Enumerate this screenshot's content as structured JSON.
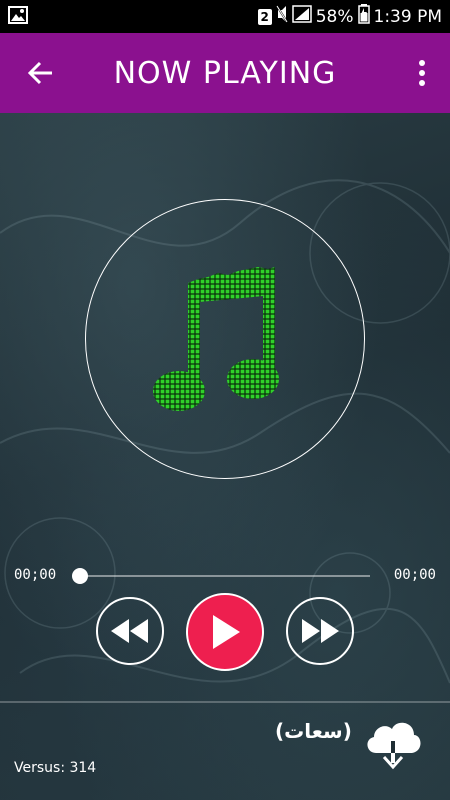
{
  "status_bar": {
    "sim_badge": "2",
    "battery_percent": "58%",
    "time": "1:39 PM"
  },
  "app_bar": {
    "title": "NOW PLAYING",
    "back_icon": "arrow-left-icon",
    "menu_icon": "more-vert-icon",
    "color": "#8b118f"
  },
  "player": {
    "artwork_icon": "music-note-icon",
    "current_time": "00;00",
    "total_time": "00;00",
    "progress": 0,
    "play_button_color": "#ee1f4f",
    "note_color": "#2fd12a"
  },
  "footer": {
    "track_title": "(سعات)",
    "download_icon": "cloud-download-icon",
    "version_text": "Versus: 314"
  }
}
